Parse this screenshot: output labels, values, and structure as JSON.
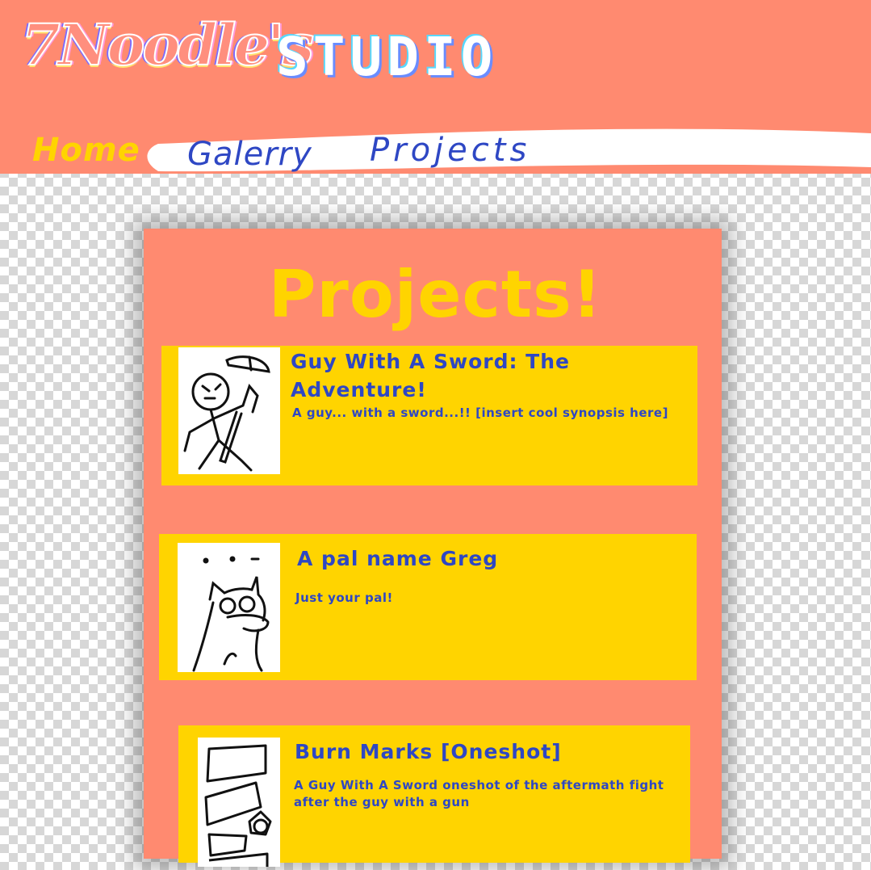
{
  "header": {
    "logo_text": "7Noodle's",
    "studio_text": "STUDIO",
    "nav": {
      "home": "Home",
      "gallery": "Galerry",
      "projects": "Projects"
    }
  },
  "main": {
    "title": "Projects!",
    "projects": [
      {
        "title_line1": "Guy With A Sword: The",
        "title_line2": "Adventure!",
        "description": "A guy... with a sword...!! [insert cool synopsis here]"
      },
      {
        "title_line1": "A pal name Greg",
        "description": "Just your pal!"
      },
      {
        "title_line1": "Burn Marks [Oneshot]",
        "description_line1": "A Guy With A Sword oneshot of the aftermath fight",
        "description_line2": "after the guy with a gun"
      }
    ]
  },
  "colors": {
    "header_bg": "#ff8a70",
    "accent_yellow": "#ffd400",
    "link_blue": "#2e47c4",
    "checker": "#d7d7d7"
  }
}
